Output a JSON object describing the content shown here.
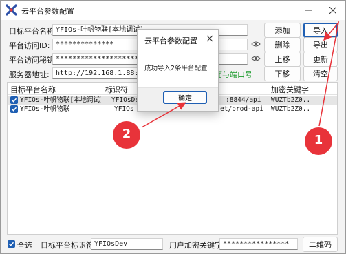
{
  "window": {
    "title": "云平台参数配置"
  },
  "form": {
    "platform_name_label": "目标平台名称:",
    "platform_name_value": "YFIOs-叶帆物联[本地调试]",
    "access_id_label": "平台访问ID:",
    "access_id_value": "**************",
    "access_secret_label": "平台访问秘钥:",
    "access_secret_value": "************************************",
    "server_label": "服务器地址:",
    "server_value": "http://192.168.1.88:8844/ap",
    "server_hint": "面与端口号"
  },
  "buttons": {
    "add": "添加",
    "import": "导入",
    "delete": "删除",
    "export": "导出",
    "move_up": "上移",
    "update": "更新",
    "move_down": "下移",
    "clear": "清空",
    "qrcode": "二维码"
  },
  "table": {
    "headers": [
      "目标平台名称",
      "标识符",
      "",
      "加密关键字"
    ],
    "rows": [
      {
        "name": "YFIOs-叶帆物联[本地调试]",
        "id": "YFIOsDev",
        "url": ":8844/api",
        "key": "WUZTb2Z0...",
        "checked": true
      },
      {
        "name": "YFIOs-叶帆物联",
        "id": "YFIOs",
        "url": "et/prod-api",
        "key": "WUZTb2Z0...",
        "checked": true
      }
    ]
  },
  "footer": {
    "select_all": "全选",
    "identifier_label": "目标平台标识符:",
    "identifier_value": "YFIOsDev",
    "user_key_label": "用户加密关键字:",
    "user_key_value": "****************"
  },
  "dialog": {
    "title": "云平台参数配置",
    "message": "成功导入2条平台配置",
    "ok": "确定"
  },
  "annotations": {
    "marker_1": "1",
    "marker_2": "2",
    "color": "#e8333a"
  },
  "colors": {
    "accent": "#1f5fb3",
    "hint_green": "#1a9a2a"
  }
}
